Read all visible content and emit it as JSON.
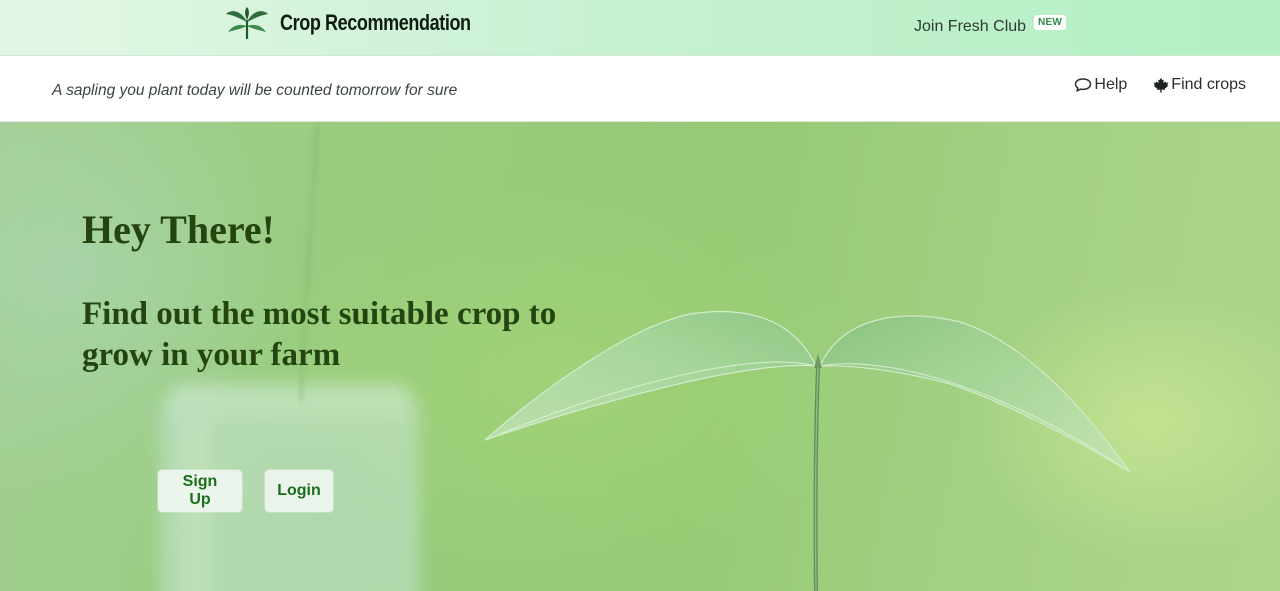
{
  "header": {
    "brand_title": "Crop Recommendation",
    "brand_icon": "sprout-logo-icon",
    "join_label": "Join Fresh Club",
    "join_badge": "NEW"
  },
  "subheader": {
    "tagline": "A sapling you plant today will be counted tomorrow for sure",
    "nav": [
      {
        "label": "Help",
        "icon": "chat-bubble-icon"
      },
      {
        "label": "Find crops",
        "icon": "maple-leaf-icon"
      }
    ]
  },
  "hero": {
    "title": "Hey There!",
    "subtitle": "Find out the most suitable crop to grow in your farm",
    "buttons": {
      "signup": "Sign Up",
      "login": "Login"
    }
  },
  "colors": {
    "topbar_start": "#e3f7e6",
    "topbar_end": "#b2efc2",
    "hero_text": "#24450f",
    "button_text": "#1b6e1b",
    "badge_text": "#2d8c48"
  }
}
